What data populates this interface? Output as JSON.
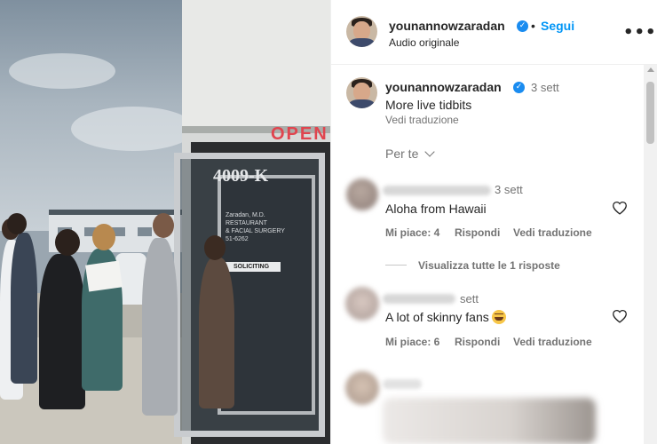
{
  "post_header": {
    "username": "younannowzaradan",
    "follow_label": "Segui",
    "audio_label": "Audio originale",
    "more_label": "•••"
  },
  "caption": {
    "username": "younannowzaradan",
    "time": "3 sett",
    "text": "More live tidbits",
    "translate_label": "Vedi traduzione"
  },
  "filter": {
    "label": "Per te"
  },
  "comments": [
    {
      "time": "3 sett",
      "text": "Aloha from Hawaii",
      "likes_label": "Mi piace: 4",
      "reply_label": "Rispondi",
      "translate_label": "Vedi traduzione",
      "view_replies_label": "Visualizza tutte le 1 risposte"
    },
    {
      "time": "sett",
      "text": "A lot of skinny fans",
      "emoji": "laughing-face",
      "likes_label": "Mi piace: 6",
      "reply_label": "Rispondi",
      "translate_label": "Vedi traduzione"
    }
  ],
  "media": {
    "door_number": "4009-K",
    "door_sign_lines": [
      "Zaradan, M.D.",
      "RESTAURANT",
      "& FACIAL SURGERY",
      "51-6262"
    ],
    "door_sticker": "SOLICITING"
  },
  "colors": {
    "accent": "#0095f6",
    "verified": "#1a8cf0",
    "secondary_text": "#737373"
  },
  "icons": {
    "verified": "verified-badge-icon",
    "heart": "heart-outline-icon",
    "chevron": "chevron-down-icon",
    "more": "more-horizontal-icon"
  }
}
